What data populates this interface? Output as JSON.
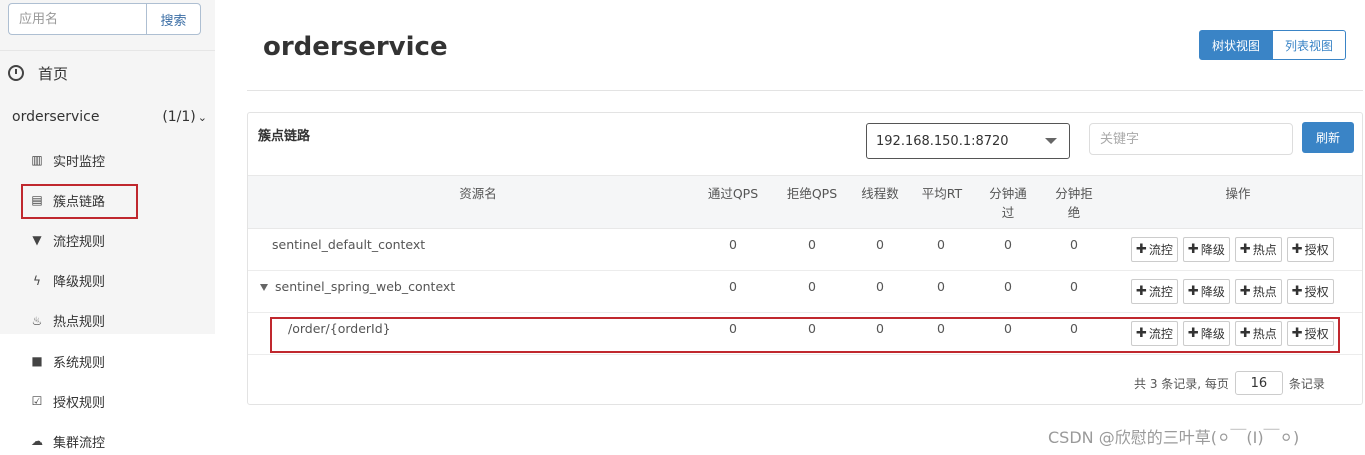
{
  "sidebar": {
    "search_placeholder": "应用名",
    "search_button": "搜索",
    "home": "首页",
    "app_name": "orderservice",
    "app_count": "(1/1)",
    "items": [
      {
        "label": "实时监控",
        "icon": "bar-chart-icon",
        "glyph": "📊"
      },
      {
        "label": "簇点链路",
        "icon": "list-icon",
        "glyph": "▤"
      },
      {
        "label": "流控规则",
        "icon": "filter-icon",
        "glyph": "▼"
      },
      {
        "label": "降级规则",
        "icon": "flash-icon",
        "glyph": "⚡"
      },
      {
        "label": "热点规则",
        "icon": "fire-icon",
        "glyph": "🔥"
      },
      {
        "label": "系统规则",
        "icon": "lock-icon",
        "glyph": "🔒"
      },
      {
        "label": "授权规则",
        "icon": "check-square-icon",
        "glyph": "☑"
      },
      {
        "label": "集群流控",
        "icon": "cloud-icon",
        "glyph": "☁"
      }
    ]
  },
  "header": {
    "title": "orderservice",
    "view_tree": "树状视图",
    "view_list": "列表视图"
  },
  "panel": {
    "title": "簇点链路",
    "machine": "192.168.150.1:8720",
    "keyword_placeholder": "关键字",
    "refresh": "刷新"
  },
  "table": {
    "headers": {
      "resource": "资源名",
      "pass_qps": "通过QPS",
      "block_qps": "拒绝QPS",
      "threads": "线程数",
      "avg_rt": "平均RT",
      "min_pass_1": "分钟通",
      "min_pass_2": "过",
      "min_block_1": "分钟拒",
      "min_block_2": "绝",
      "ops": "操作"
    },
    "ops": {
      "flow": "流控",
      "degrade": "降级",
      "hot": "热点",
      "auth": "授权"
    },
    "rows": [
      {
        "name": "sentinel_default_context",
        "pass": "0",
        "block": "0",
        "threads": "0",
        "rt": "0",
        "mpass": "0",
        "mblock": "0"
      },
      {
        "name": "sentinel_spring_web_context",
        "pass": "0",
        "block": "0",
        "threads": "0",
        "rt": "0",
        "mpass": "0",
        "mblock": "0"
      },
      {
        "name": "/order/{orderId}",
        "pass": "0",
        "block": "0",
        "threads": "0",
        "rt": "0",
        "mpass": "0",
        "mblock": "0"
      }
    ]
  },
  "pager": {
    "prefix": "共 3 条记录, 每页",
    "size": "16",
    "suffix": "条记录"
  },
  "watermark": "CSDN @欣慰的三叶草(⚪￣(I)￣⚪)"
}
